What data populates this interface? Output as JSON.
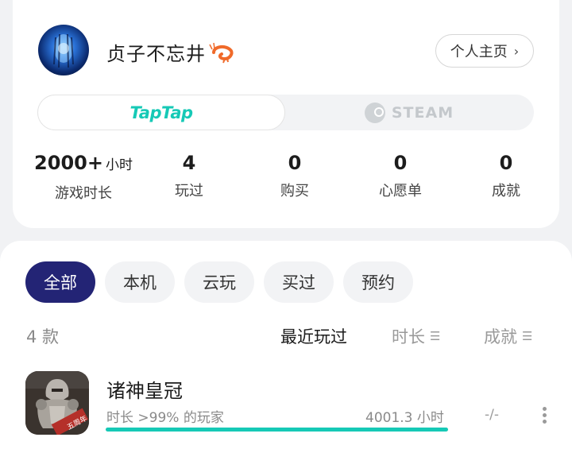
{
  "profile": {
    "username": "贞子不忘井",
    "home_button": "个人主页",
    "platforms": {
      "active": "TapTap",
      "inactive": "STEAM"
    }
  },
  "stats": [
    {
      "value": "2000+",
      "unit": "小时",
      "label": "游戏时长"
    },
    {
      "value": "4",
      "unit": "",
      "label": "玩过"
    },
    {
      "value": "0",
      "unit": "",
      "label": "购买"
    },
    {
      "value": "0",
      "unit": "",
      "label": "心愿单"
    },
    {
      "value": "0",
      "unit": "",
      "label": "成就"
    }
  ],
  "filters": [
    "全部",
    "本机",
    "云玩",
    "买过",
    "预约"
  ],
  "active_filter": "全部",
  "list": {
    "count": "4 款",
    "sort_recent": "最近玩过",
    "sort_duration": "时长",
    "sort_achievement": "成就"
  },
  "games": [
    {
      "title": "诸神皇冠",
      "percentile": "时长 >99% 的玩家",
      "hours": "4001.3 小时",
      "achievements": "-/-",
      "progress": 1.0
    }
  ],
  "colors": {
    "accent": "#16c9b6",
    "active_chip": "#232475"
  }
}
